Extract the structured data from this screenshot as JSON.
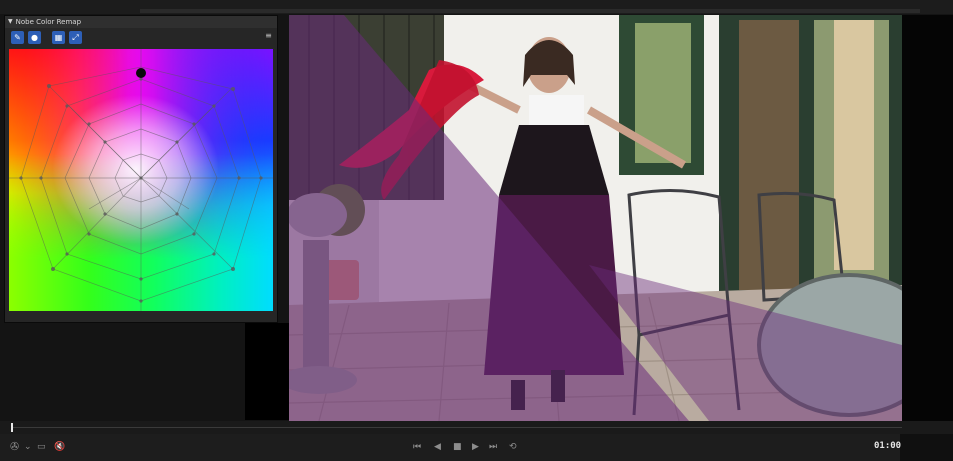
{
  "panel": {
    "title": "Nobe Color Remap",
    "collapse_glyph": "▼",
    "tools": [
      {
        "name": "eyedropper-icon",
        "glyph": "✎"
      },
      {
        "name": "dot-icon",
        "glyph": "●"
      },
      {
        "name": "grid-icon",
        "glyph": "▦"
      },
      {
        "name": "expand-icon",
        "glyph": "⤢"
      }
    ],
    "menu_glyph": "≡"
  },
  "viewer": {
    "frame_description_colors": {
      "overlay": "#6a2a7a",
      "scarf": "#d81a3c",
      "dress": "#4a1a45"
    }
  },
  "transport": {
    "buttons": [
      {
        "name": "skip-to-start-icon",
        "glyph": "⏮"
      },
      {
        "name": "step-back-icon",
        "glyph": "◀"
      },
      {
        "name": "stop-icon",
        "glyph": "■"
      },
      {
        "name": "play-icon",
        "glyph": "▶"
      },
      {
        "name": "skip-to-end-icon",
        "glyph": "⏭"
      },
      {
        "name": "loop-icon",
        "glyph": "⟲"
      }
    ],
    "left_icons": [
      {
        "name": "color-wheel-icon",
        "glyph": "✇"
      },
      {
        "name": "dropdown-arrow-icon",
        "glyph": "⌄"
      },
      {
        "name": "layers-icon",
        "glyph": "▭"
      },
      {
        "name": "mute-icon",
        "glyph": "🔇"
      }
    ],
    "timecode": "01:00"
  },
  "colors": {
    "accent": "#2d5fb7",
    "panel_bg": "#262626",
    "app_bg": "#141414"
  }
}
